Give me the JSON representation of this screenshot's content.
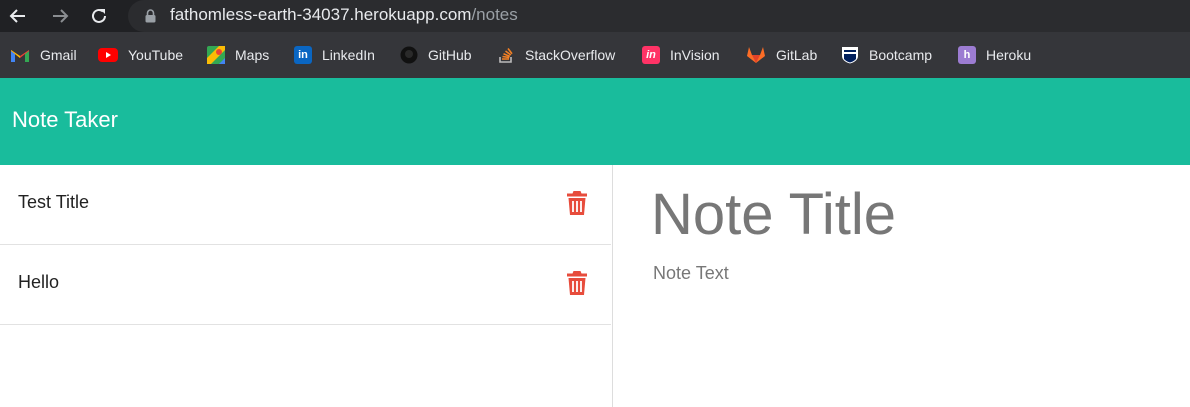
{
  "browser": {
    "url_host": "fathomless-earth-34037.herokuapp.com",
    "url_path": "/notes",
    "bookmarks": [
      {
        "label": "Gmail",
        "icon": "gmail-icon"
      },
      {
        "label": "YouTube",
        "icon": "youtube-icon"
      },
      {
        "label": "Maps",
        "icon": "maps-icon"
      },
      {
        "label": "LinkedIn",
        "icon": "linkedin-icon"
      },
      {
        "label": "GitHub",
        "icon": "github-icon"
      },
      {
        "label": "StackOverflow",
        "icon": "stackoverflow-icon"
      },
      {
        "label": "InVision",
        "icon": "invision-icon"
      },
      {
        "label": "GitLab",
        "icon": "gitlab-icon"
      },
      {
        "label": "Bootcamp",
        "icon": "bootcamp-icon"
      },
      {
        "label": "Heroku",
        "icon": "heroku-icon"
      }
    ]
  },
  "app": {
    "title": "Note Taker",
    "header_color": "#19bc9c"
  },
  "notes": [
    {
      "title": "Test Title"
    },
    {
      "title": "Hello"
    }
  ],
  "editor": {
    "title_placeholder": "Note Title",
    "text_placeholder": "Note Text"
  },
  "colors": {
    "delete_icon": "#e74c3c"
  }
}
